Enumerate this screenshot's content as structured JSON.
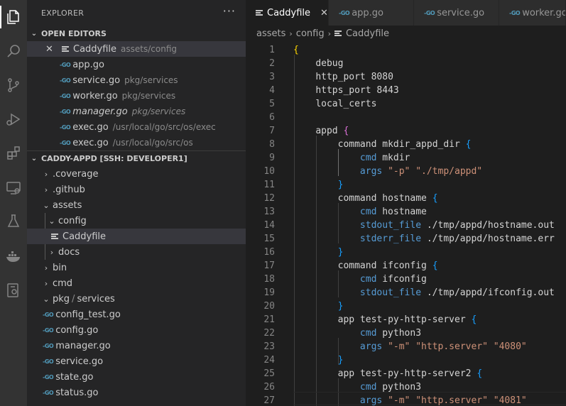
{
  "activity_bar": {
    "icons": [
      "explorer-icon",
      "search-icon",
      "source-control-icon",
      "run-debug-icon",
      "extensions-icon",
      "remote-explorer-icon",
      "testing-icon",
      "docker-icon",
      "remote-settings-icon"
    ]
  },
  "sidebar": {
    "title": "EXPLORER",
    "more": "···",
    "open_editors": {
      "header": "OPEN EDITORS",
      "items": [
        {
          "name": "Caddyfile",
          "path": "assets/config",
          "close": "✕"
        },
        {
          "name": "app.go",
          "path": ""
        },
        {
          "name": "service.go",
          "path": "pkg/services"
        },
        {
          "name": "worker.go",
          "path": "pkg/services"
        },
        {
          "name": "manager.go",
          "path": "pkg/services"
        },
        {
          "name": "exec.go",
          "path": "/usr/local/go/src/os/exec"
        },
        {
          "name": "exec.go",
          "path": "/usr/local/go/src/os"
        }
      ]
    },
    "workspace": {
      "header": "CADDY-APPD [SSH: DEVELOPER1]",
      "tree": [
        {
          "label": ".coverage"
        },
        {
          "label": ".github"
        },
        {
          "label": "assets"
        },
        {
          "label": "config"
        },
        {
          "label": "Caddyfile"
        },
        {
          "label": "docs"
        },
        {
          "label": "bin"
        },
        {
          "label": "cmd"
        },
        {
          "label": "pkg",
          "label2": "services",
          "sep": "/"
        },
        {
          "label": "config_test.go"
        },
        {
          "label": "config.go"
        },
        {
          "label": "manager.go"
        },
        {
          "label": "service.go"
        },
        {
          "label": "state.go"
        },
        {
          "label": "status.go"
        }
      ]
    }
  },
  "tabs": [
    {
      "label": "Caddyfile",
      "close": "✕"
    },
    {
      "label": "app.go"
    },
    {
      "label": "service.go"
    },
    {
      "label": "worker.go"
    }
  ],
  "go_badge": "-GO",
  "breadcrumb": [
    "assets",
    "config",
    "Caddyfile"
  ],
  "editor": {
    "lines": [
      {
        "n": "1",
        "t": "{"
      },
      {
        "n": "2",
        "t": "    debug"
      },
      {
        "n": "3",
        "t": "    http_port 8080"
      },
      {
        "n": "4",
        "t": "    https_port 8443"
      },
      {
        "n": "5",
        "t": "    local_certs"
      },
      {
        "n": "6",
        "t": ""
      },
      {
        "n": "7",
        "t": "    appd {"
      },
      {
        "n": "8",
        "t": "        command mkdir_appd_dir {"
      },
      {
        "n": "9",
        "t": "            cmd mkdir"
      },
      {
        "n": "10",
        "t": "            args \"-p\" \"./tmp/appd\""
      },
      {
        "n": "11",
        "t": "        }"
      },
      {
        "n": "12",
        "t": "        command hostname {"
      },
      {
        "n": "13",
        "t": "            cmd hostname"
      },
      {
        "n": "14",
        "t": "            stdout_file ./tmp/appd/hostname.out"
      },
      {
        "n": "15",
        "t": "            stderr_file ./tmp/appd/hostname.err"
      },
      {
        "n": "16",
        "t": "        }"
      },
      {
        "n": "17",
        "t": "        command ifconfig {"
      },
      {
        "n": "18",
        "t": "            cmd ifconfig"
      },
      {
        "n": "19",
        "t": "            stdout_file ./tmp/appd/ifconfig.out"
      },
      {
        "n": "20",
        "t": "        }"
      },
      {
        "n": "21",
        "t": "        app test-py-http-server {"
      },
      {
        "n": "22",
        "t": "            cmd python3"
      },
      {
        "n": "23",
        "t": "            args \"-m\" \"http.server\" \"4080\""
      },
      {
        "n": "24",
        "t": "        }"
      },
      {
        "n": "25",
        "t": "        app test-py-http-server2 {"
      },
      {
        "n": "26",
        "t": "            cmd python3"
      },
      {
        "n": "27",
        "t": "            args \"-m\" \"http.server\" \"4081\""
      }
    ]
  },
  "colors": {
    "keyword": "#569cd6",
    "string": "#ce9178",
    "bracket_level1": "#ffd700",
    "bracket_level2": "#da70d6",
    "bracket_level3": "#179fff",
    "go_icon": "#519aba"
  }
}
